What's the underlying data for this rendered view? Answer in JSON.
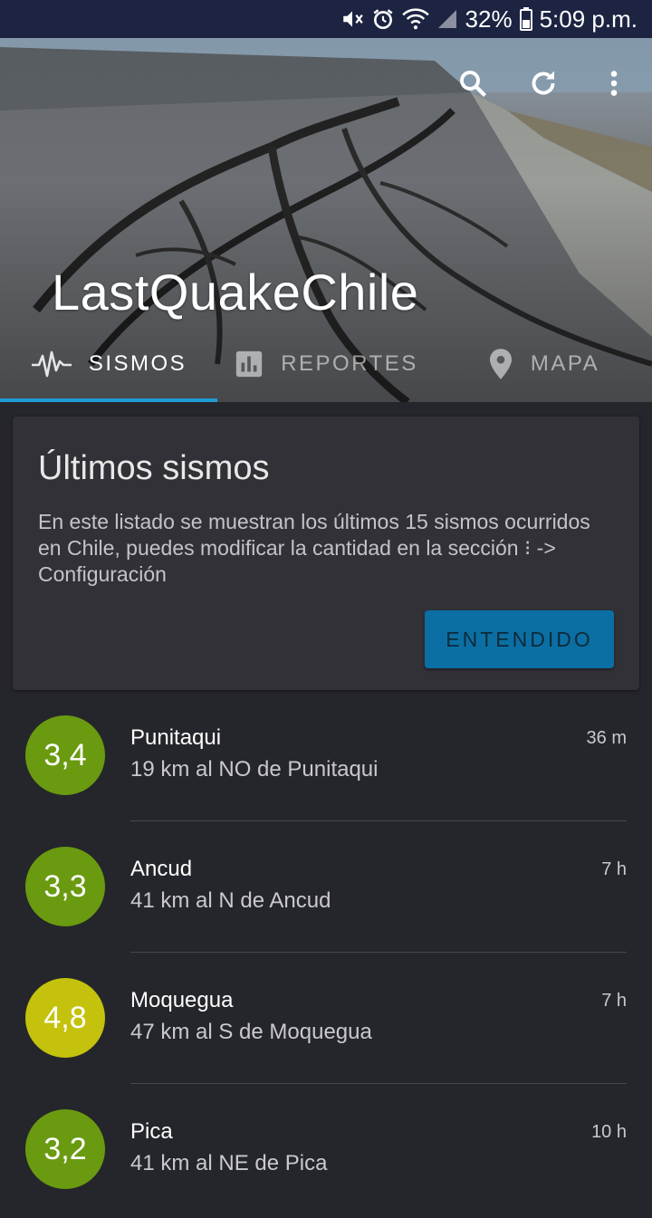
{
  "status_bar": {
    "battery": "32%",
    "time": "5:09 p.m.",
    "icons": [
      "mute-icon",
      "alarm-icon",
      "wifi-icon",
      "signal-icon",
      "battery-icon"
    ]
  },
  "header": {
    "app_title": "LastQuakeChile",
    "actions": [
      "search-icon",
      "refresh-icon",
      "more-vert-icon"
    ],
    "tabs": [
      {
        "label": "SISMOS",
        "icon": "seismograph-icon",
        "active": true
      },
      {
        "label": "REPORTES",
        "icon": "bar-chart-icon",
        "active": false
      },
      {
        "label": "MAPA",
        "icon": "map-pin-icon",
        "active": false
      }
    ],
    "accent_color": "#1e9bd7"
  },
  "info_card": {
    "title": "Últimos sismos",
    "body": "En este listado se muestran los últimos 15 sismos ocurridos en Chile, puedes modificar la cantidad en la sección ⁝ -> Configuración",
    "button_label": "ENTENDIDO",
    "button_color": "#0b6fa4"
  },
  "quakes": [
    {
      "magnitude": "3,4",
      "place": "Punitaqui",
      "reference": "19 km al NO de Punitaqui",
      "time": "36 m",
      "color": "#6a9a10"
    },
    {
      "magnitude": "3,3",
      "place": "Ancud",
      "reference": "41 km al N de Ancud",
      "time": "7 h",
      "color": "#6a9a10"
    },
    {
      "magnitude": "4,8",
      "place": "Moquegua",
      "reference": "47 km al S de Moquegua",
      "time": "7 h",
      "color": "#c4c20c"
    },
    {
      "magnitude": "3,2",
      "place": "Pica",
      "reference": "41 km al NE de Pica",
      "time": "10 h",
      "color": "#6a9a10"
    }
  ]
}
